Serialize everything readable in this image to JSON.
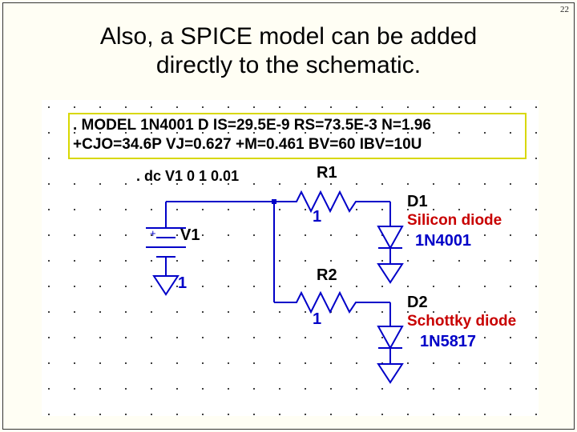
{
  "page_number": "22",
  "title_line1": "Also, a SPICE model can be added",
  "title_line2": "directly to the schematic.",
  "model_directive_line1": ". MODEL 1N4001 D IS=29.5E-9 RS=73.5E-3 N=1.96",
  "model_directive_line2": "+CJO=34.6P VJ=0.627 +M=0.461 BV=60 IBV=10U",
  "dc_sweep": ". dc V1 0 1 0.01",
  "components": {
    "v1": {
      "ref": "V1",
      "value": "1",
      "plus": "+"
    },
    "r1": {
      "ref": "R1",
      "value": "1"
    },
    "r2": {
      "ref": "R2",
      "value": "1"
    },
    "d1": {
      "ref": "D1",
      "desc": "Silicon diode",
      "part": "1N4001"
    },
    "d2": {
      "ref": "D2",
      "desc": "Schottky diode",
      "part": "1N5817"
    }
  },
  "colors": {
    "wire": "#0000c8",
    "selection_box": "#d8d800",
    "valuetext": "#000000",
    "desctext": "#c80000",
    "background": "#fffef4"
  }
}
